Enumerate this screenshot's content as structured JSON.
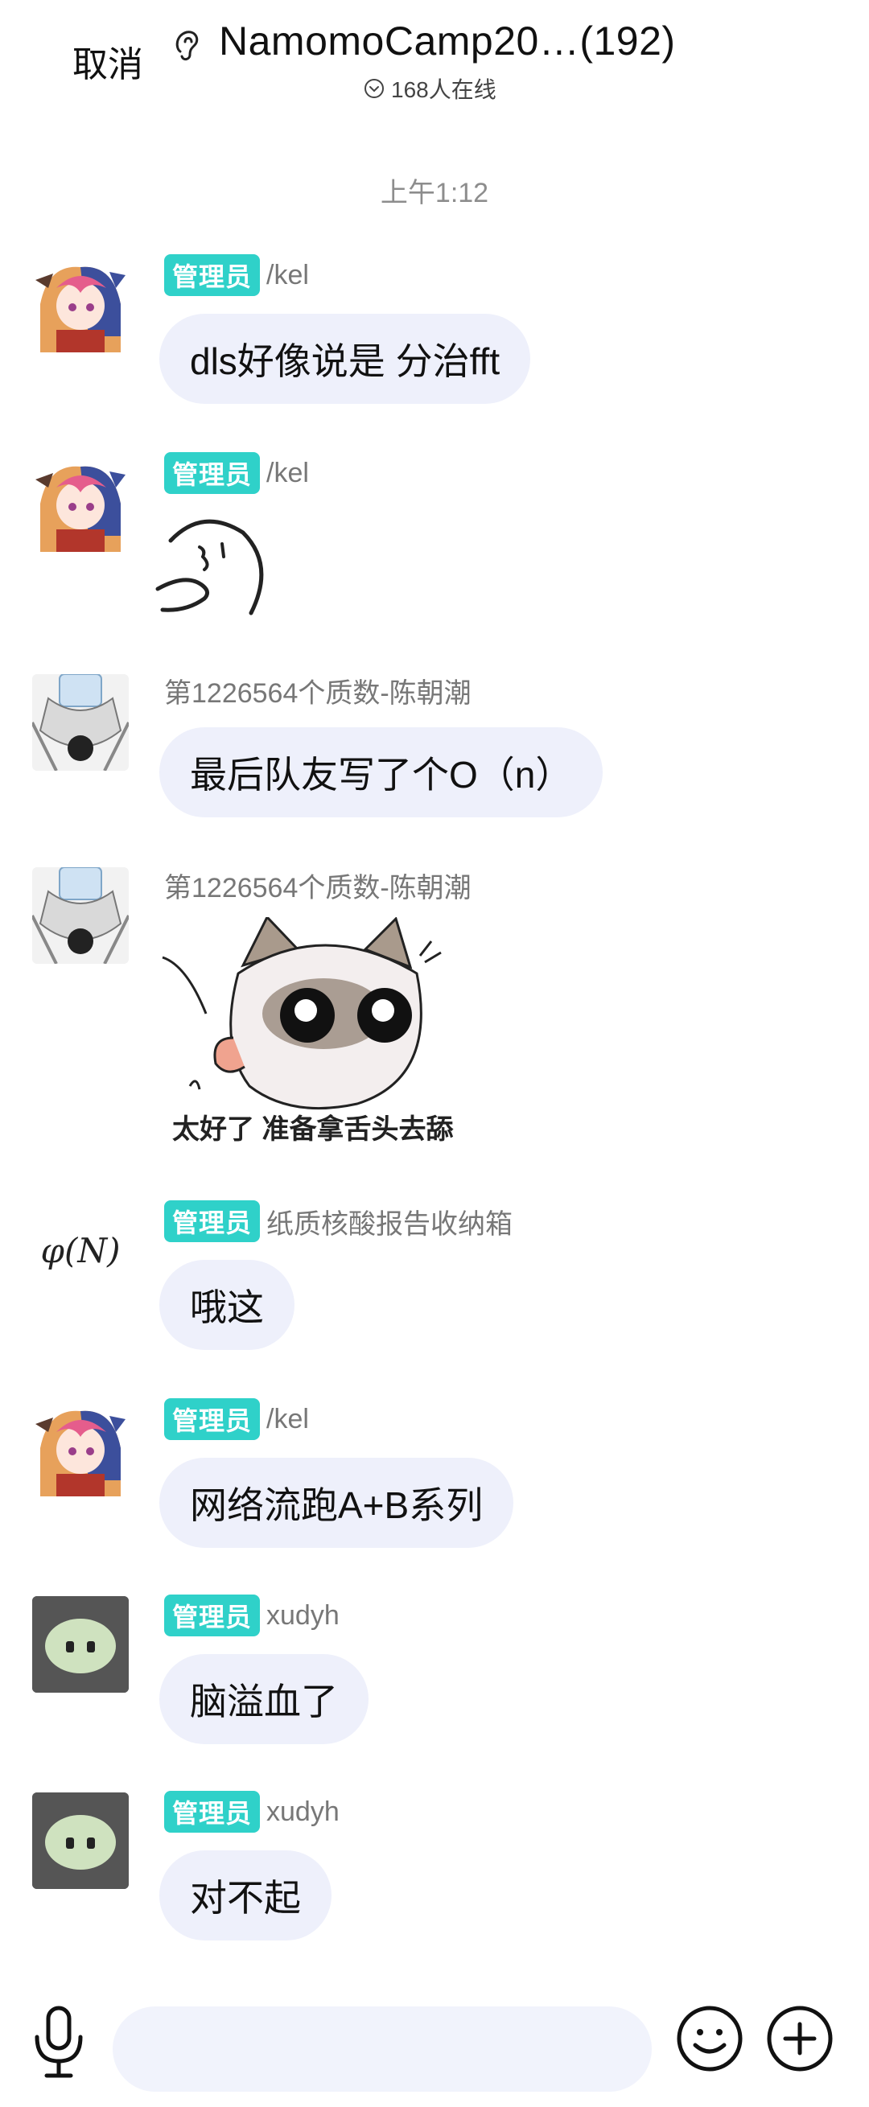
{
  "header": {
    "cancel_label": "取消",
    "ear_icon": "ear-icon",
    "title": "NamomoCamp20…(192)",
    "online_text": "168人在线"
  },
  "timestamp": "上午1:12",
  "messages": [
    {
      "badge": "管理员",
      "sender": "/kel",
      "text": "dls好像说是 分治fft"
    },
    {
      "badge": "管理员",
      "sender": "/kel",
      "sticker": "face-doodle"
    },
    {
      "badge": "",
      "sender": "第1226564个质数-陈朝潮",
      "text": "最后队友写了个O（n）"
    },
    {
      "badge": "",
      "sender": "第1226564个质数-陈朝潮",
      "sticker": "cat-sticker",
      "sticker_caption": "太好了 准备拿舌头去舔"
    },
    {
      "badge": "管理员",
      "sender": "纸质核酸报告收纳箱",
      "avatar_text": "φ(N)",
      "text": "哦这"
    },
    {
      "badge": "管理员",
      "sender": "/kel",
      "text": "网络流跑A+B系列"
    },
    {
      "badge": "管理员",
      "sender": "xudyh",
      "text": "脑溢血了"
    },
    {
      "badge": "管理员",
      "sender": "xudyh",
      "text": "对不起"
    }
  ],
  "bottom_bar": {
    "mic_icon": "microphone-icon",
    "input_value": "",
    "emoji_icon": "smiley-icon",
    "plus_icon": "plus-icon"
  },
  "colors": {
    "badge": "#2fd1c9",
    "bubble": "#eef0fb",
    "background": "#ffffff"
  }
}
